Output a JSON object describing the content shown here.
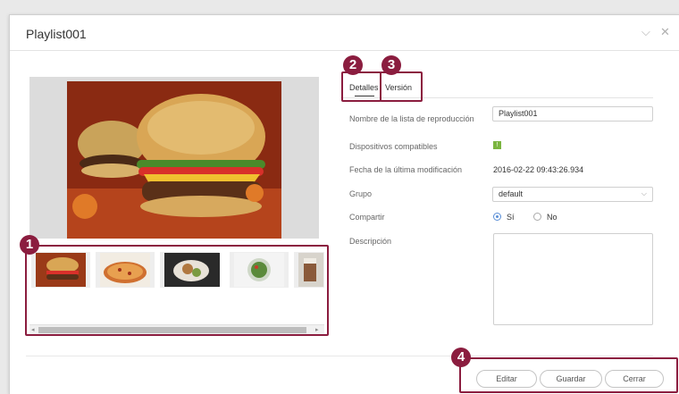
{
  "dialog": {
    "title": "Playlist001",
    "minimize_glyph": "⌵",
    "close_glyph": "✕"
  },
  "preview": {
    "image": "hamburger-photo"
  },
  "thumbnails": [
    {
      "name": "burger-thumbnail"
    },
    {
      "name": "pizza-thumbnail"
    },
    {
      "name": "dishes-thumbnail"
    },
    {
      "name": "salad-thumbnail"
    },
    {
      "name": "drink-thumbnail"
    }
  ],
  "scrollbar": {
    "left_arrow": "◂",
    "right_arrow": "▸"
  },
  "callouts": [
    "1",
    "2",
    "3",
    "4"
  ],
  "tabs": {
    "details": "Detalles",
    "version": "Versión"
  },
  "form": {
    "name_label": "Nombre de la lista de reproducción",
    "name_value": "Playlist001",
    "devices_label": "Dispositivos compatibles",
    "devices_badge": "!",
    "modified_label": "Fecha de la última modificación",
    "modified_value": "2016-02-22 09:43:26.934",
    "group_label": "Grupo",
    "group_value": "default",
    "share_label": "Compartir",
    "share_yes": "Sí",
    "share_no": "No",
    "share_selected": "Sí",
    "description_label": "Descripción",
    "description_value": ""
  },
  "footer": {
    "edit": "Editar",
    "save": "Guardar",
    "close": "Cerrar"
  },
  "colors": {
    "callout": "#8b1d3f",
    "accent": "#5b8fd6",
    "compatible": "#7bb540"
  }
}
